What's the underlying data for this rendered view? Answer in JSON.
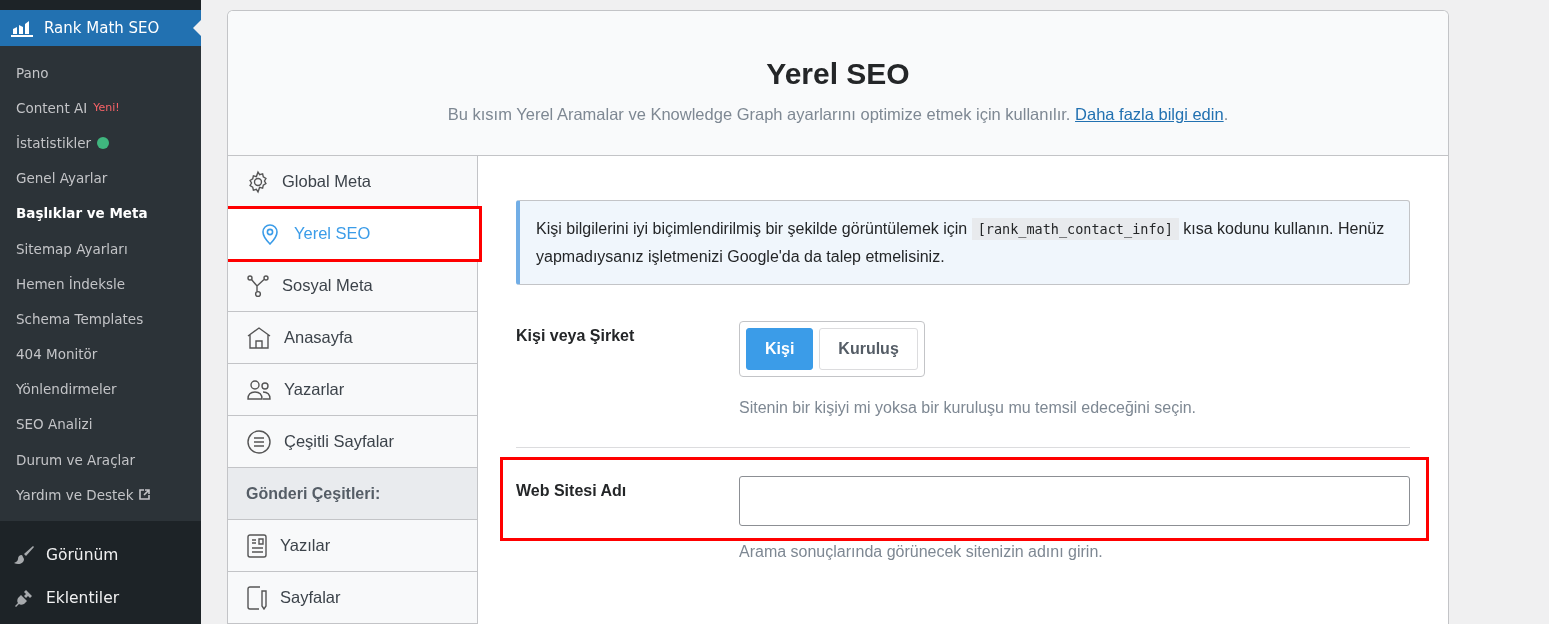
{
  "admin_menu": {
    "plugin": {
      "label": "Rank Math SEO"
    },
    "submenu": [
      {
        "label": "Pano",
        "selected": false
      },
      {
        "label": "Content AI",
        "selected": false,
        "badge": "Yeni!"
      },
      {
        "label": "İstatistikler",
        "selected": false,
        "color": "#3fb67e"
      },
      {
        "label": "Genel Ayarlar",
        "selected": false
      },
      {
        "label": "Başlıklar ve Meta",
        "selected": true
      },
      {
        "label": "Sitemap Ayarları",
        "selected": false
      },
      {
        "label": "Hemen İndeksle",
        "selected": false
      },
      {
        "label": "Schema Templates",
        "selected": false
      },
      {
        "label": "404 Monitör",
        "selected": false
      },
      {
        "label": "Yönlendirmeler",
        "selected": false
      },
      {
        "label": "SEO Analizi",
        "selected": false
      },
      {
        "label": "Durum ve Araçlar",
        "selected": false
      },
      {
        "label": "Yardım ve Destek",
        "selected": false,
        "external": true
      }
    ],
    "items": [
      {
        "label": "Görünüm"
      },
      {
        "label": "Eklentiler"
      }
    ]
  },
  "page": {
    "title": "Yerel SEO",
    "description": "Bu kısım Yerel Aramalar ve Knowledge Graph ayarlarını optimize etmek için kullanılır. ",
    "link": "Daha fazla bilgi edin",
    "after_link": "."
  },
  "tabs": [
    {
      "kind": "item",
      "label": "Global Meta",
      "selected": false,
      "highlighted": false
    },
    {
      "kind": "item",
      "label": "Yerel SEO",
      "selected": true,
      "highlighted": true
    },
    {
      "kind": "item",
      "label": "Sosyal Meta",
      "selected": false,
      "highlighted": false
    },
    {
      "kind": "item",
      "label": "Anasayfa",
      "selected": false,
      "highlighted": false
    },
    {
      "kind": "item",
      "label": "Yazarlar",
      "selected": false,
      "highlighted": false
    },
    {
      "kind": "item",
      "label": "Çeşitli Sayfalar",
      "selected": false,
      "highlighted": false
    },
    {
      "kind": "heading",
      "label": "Gönderi Çeşitleri:"
    },
    {
      "kind": "item",
      "label": "Yazılar",
      "selected": false,
      "highlighted": false
    },
    {
      "kind": "item",
      "label": "Sayfalar",
      "selected": false,
      "highlighted": false
    }
  ],
  "notice": {
    "before": "Kişi bilgilerini iyi biçimlendirilmiş bir şekilde görüntülemek için ",
    "code": "[rank_math_contact_info]",
    "after": " kısa kodunu kullanın. Henüz yapmadıysanız işletmenizi Google'da da talep etmelisiniz."
  },
  "fields": [
    {
      "kind": "toggle",
      "label": "Kişi veya Şirket",
      "highlighted": false,
      "options": [
        {
          "label": "Kişi",
          "selected": true
        },
        {
          "label": "Kuruluş",
          "selected": false
        }
      ],
      "description": "Sitenin bir kişiyi mi yoksa bir kuruluşu mu temsil edeceğini seçin."
    },
    {
      "kind": "text",
      "label": "Web Sitesi Adı",
      "highlighted": true,
      "description": "Arama sonuçlarında görünecek sitenizin adını girin."
    }
  ]
}
